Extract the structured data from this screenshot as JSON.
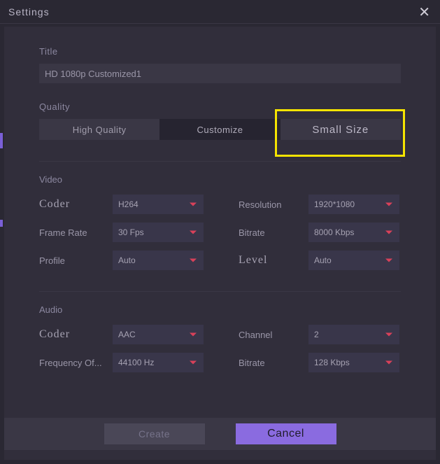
{
  "window": {
    "title": "Settings"
  },
  "title": {
    "label": "Title",
    "value": "HD 1080p Customized1"
  },
  "quality": {
    "label": "Quality",
    "options": {
      "high": "High Quality",
      "customize": "Customize",
      "small": "Small Size"
    }
  },
  "video": {
    "header": "Video",
    "coder": {
      "label": "Coder",
      "value": "H264"
    },
    "resolution": {
      "label": "Resolution",
      "value": "1920*1080"
    },
    "framerate": {
      "label": "Frame Rate",
      "value": "30 Fps"
    },
    "bitrate": {
      "label": "Bitrate",
      "value": "8000 Kbps"
    },
    "profile": {
      "label": "Profile",
      "value": "Auto"
    },
    "level": {
      "label": "Level",
      "value": "Auto"
    }
  },
  "audio": {
    "header": "Audio",
    "coder": {
      "label": "Coder",
      "value": "AAC"
    },
    "channel": {
      "label": "Channel",
      "value": "2"
    },
    "frequency": {
      "label": "Frequency Of...",
      "value": "44100 Hz"
    },
    "bitrate": {
      "label": "Bitrate",
      "value": "128 Kbps"
    }
  },
  "footer": {
    "create": "Create",
    "cancel": "Cancel"
  }
}
